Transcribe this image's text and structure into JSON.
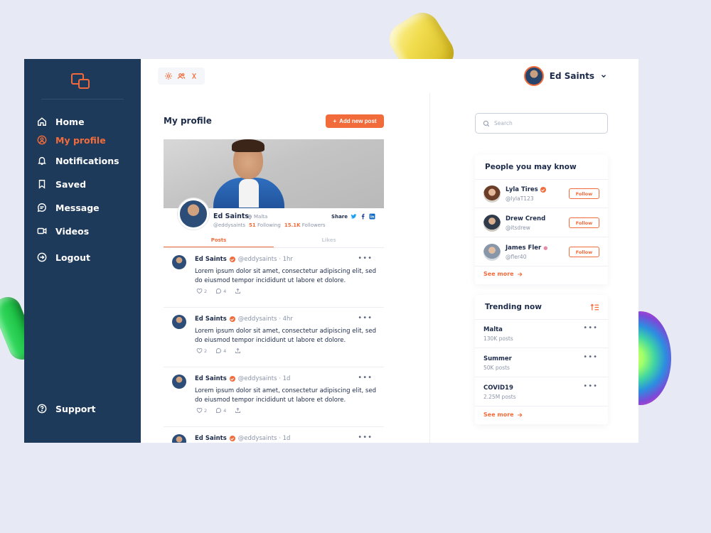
{
  "colors": {
    "sidebar": "#1e3a5a",
    "accent": "#f26b3a",
    "text": "#1d2b4a",
    "muted": "#8a94a8"
  },
  "nav": {
    "items": [
      {
        "label": "Home",
        "icon": "home-icon"
      },
      {
        "label": "My profile",
        "icon": "user-circle-icon",
        "active": true
      },
      {
        "label": "Notifications",
        "icon": "bell-icon"
      },
      {
        "label": "Saved",
        "icon": "bookmark-icon"
      },
      {
        "label": "Message",
        "icon": "message-icon"
      },
      {
        "label": "Videos",
        "icon": "video-icon"
      },
      {
        "label": "Logout",
        "icon": "logout-icon"
      }
    ],
    "support": "Support"
  },
  "topbar": {
    "user_name": "Ed Saints"
  },
  "main": {
    "title": "My profile",
    "add_button": "Add new post",
    "profile": {
      "name": "Ed Saints",
      "location": "Malta",
      "handle": "@eddysaints",
      "following_count": "51",
      "following_label": "Following",
      "followers_count": "15.1K",
      "followers_label": "Followers",
      "share_label": "Share"
    },
    "tabs": [
      "Posts",
      "Likes"
    ],
    "posts": [
      {
        "author": "Ed Saints",
        "meta": "@eddysaints · 1hr",
        "body": "Lorem ipsum dolor sit amet, consectetur adipiscing elit, sed do eiusmod tempor incididunt ut labore et dolore.",
        "likes": "2",
        "comments": "4"
      },
      {
        "author": "Ed Saints",
        "meta": "@eddysaints · 4hr",
        "body": "Lorem ipsum dolor sit amet, consectetur adipiscing elit, sed do eiusmod tempor incididunt ut labore et dolore.",
        "likes": "2",
        "comments": "4"
      },
      {
        "author": "Ed Saints",
        "meta": "@eddysaints · 1d",
        "body": "Lorem ipsum dolor sit amet, consectetur adipiscing elit, sed do eiusmod tempor incididunt ut labore et dolore.",
        "likes": "2",
        "comments": "4"
      },
      {
        "author": "Ed Saints",
        "meta": "@eddysaints · 1d",
        "body": "",
        "likes": "",
        "comments": ""
      }
    ]
  },
  "right": {
    "search_placeholder": "Search",
    "people": {
      "title": "People you may know",
      "items": [
        {
          "name": "Lyla Tires",
          "handle": "@lylaT123",
          "follow": "Follow"
        },
        {
          "name": "Drew Crend",
          "handle": "@itsdrew",
          "follow": "Follow"
        },
        {
          "name": "James Fler",
          "handle": "@fler40",
          "follow": "Follow"
        }
      ],
      "see_more": "See more"
    },
    "trending": {
      "title": "Trending now",
      "items": [
        {
          "name": "Malta",
          "count": "130K posts"
        },
        {
          "name": "Summer",
          "count": "50K posts"
        },
        {
          "name": "COVID19",
          "count": "2.25M posts"
        }
      ],
      "see_more": "See more"
    }
  }
}
